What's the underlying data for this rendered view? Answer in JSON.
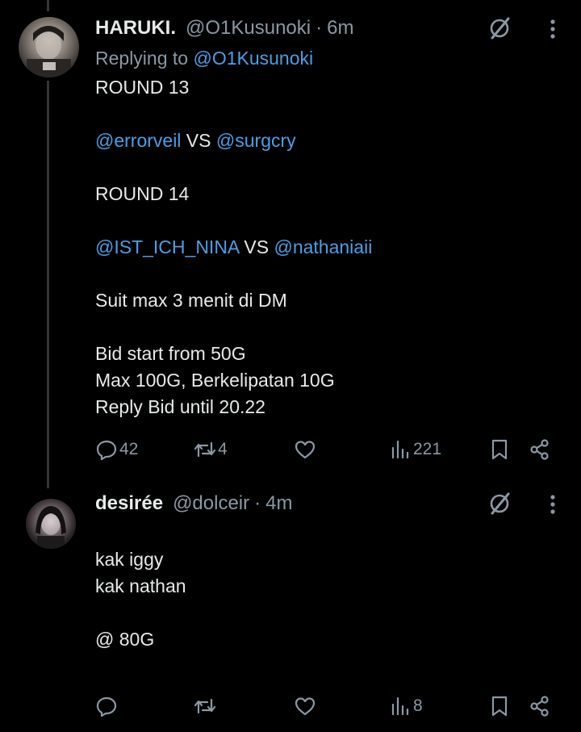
{
  "colors": {
    "background": "#000000",
    "text": "#e7e9ea",
    "muted": "#8b98a5",
    "mention": "#4b9fe6",
    "thread_line": "#333639"
  },
  "tweets": [
    {
      "display_name": "HARUKI.",
      "handle": "@O1Kusunoki",
      "separator": "·",
      "time": "6m",
      "replying_prefix": "Replying to",
      "replying_handle": "@O1Kusunoki",
      "lines": [
        {
          "parts": [
            {
              "text": "ROUND 13",
              "mention": false
            }
          ]
        },
        {
          "parts": []
        },
        {
          "parts": [
            {
              "text": "@errorveil",
              "mention": true
            },
            {
              "text": " VS ",
              "mention": false
            },
            {
              "text": "@surgcry",
              "mention": true
            }
          ]
        },
        {
          "parts": []
        },
        {
          "parts": [
            {
              "text": "ROUND 14",
              "mention": false
            }
          ]
        },
        {
          "parts": []
        },
        {
          "parts": [
            {
              "text": "@IST_ICH_NINA",
              "mention": true
            },
            {
              "text": " VS ",
              "mention": false
            },
            {
              "text": "@nathaniaii",
              "mention": true
            }
          ]
        },
        {
          "parts": []
        },
        {
          "parts": [
            {
              "text": "Suit max 3 menit di DM",
              "mention": false
            }
          ]
        },
        {
          "parts": []
        },
        {
          "parts": [
            {
              "text": "Bid start from 50G",
              "mention": false
            }
          ]
        },
        {
          "parts": [
            {
              "text": "Max 100G, Berkelipatan 10G",
              "mention": false
            }
          ]
        },
        {
          "parts": [
            {
              "text": "Reply Bid until 20.22",
              "mention": false
            }
          ]
        }
      ],
      "stats": {
        "replies": "42",
        "reposts": "4",
        "likes": "",
        "views": "221"
      },
      "icons": [
        "grok-icon",
        "more-icon",
        "reply-icon",
        "repost-icon",
        "like-icon",
        "views-icon",
        "bookmark-icon",
        "share-icon"
      ]
    },
    {
      "display_name": "desirée",
      "handle": "@dolceir",
      "separator": "·",
      "time": "4m",
      "lines": [
        {
          "parts": []
        },
        {
          "parts": [
            {
              "text": "kak iggy",
              "mention": false
            }
          ]
        },
        {
          "parts": [
            {
              "text": "kak nathan",
              "mention": false
            }
          ]
        },
        {
          "parts": []
        },
        {
          "parts": [
            {
              "text": "@ 80G",
              "mention": false
            }
          ]
        }
      ],
      "stats": {
        "replies": "",
        "reposts": "",
        "likes": "",
        "views": "8"
      },
      "icons": [
        "grok-icon",
        "more-icon",
        "reply-icon",
        "repost-icon",
        "like-icon",
        "views-icon",
        "bookmark-icon",
        "share-icon"
      ]
    }
  ]
}
